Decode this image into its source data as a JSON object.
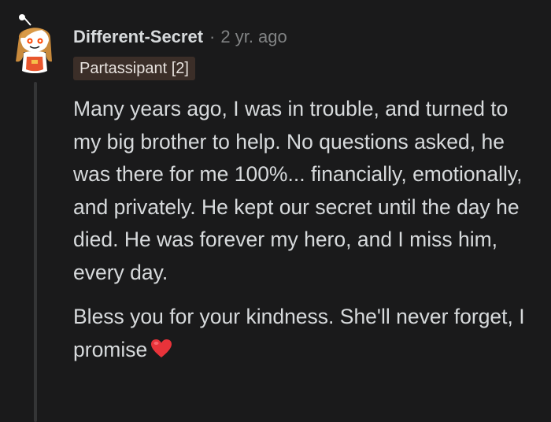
{
  "comment": {
    "author": "Different-Secret",
    "separator": "·",
    "timestamp": "2 yr. ago",
    "flair": "Partassipant [2]",
    "paragraphs": [
      "Many years ago, I was in trouble, and turned to my big brother to help. No questions asked, he was there for me 100%... financially, emotionally, and privately. He kept our secret until the day he died. He was forever my hero, and I miss him, every day.",
      "Bless you for your kindness. She'll never forget, I promise"
    ],
    "emoji": "red-heart-icon",
    "avatar_icon": "snoo-avatar-icon"
  },
  "colors": {
    "background": "#1a1a1b",
    "text": "#d7dadc",
    "muted": "#818384",
    "flair_bg": "#3b2e28",
    "thread_line": "#343536",
    "heart": "#e8333a"
  }
}
